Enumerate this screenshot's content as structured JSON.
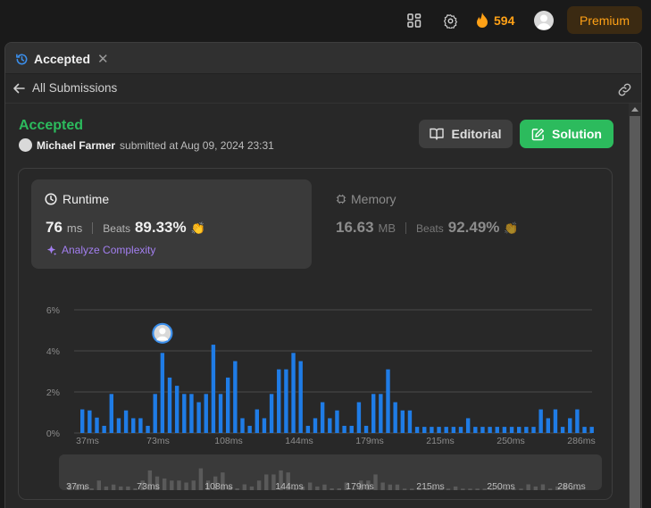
{
  "topbar": {
    "streak_count": "594",
    "premium_label": "Premium"
  },
  "tab": {
    "label": "Accepted"
  },
  "nav": {
    "back_label": "All Submissions"
  },
  "submission": {
    "status": "Accepted",
    "user": "Michael Farmer",
    "submitted_text": "submitted at Aug 09, 2024 23:31"
  },
  "buttons": {
    "editorial": "Editorial",
    "solution": "Solution"
  },
  "runtime": {
    "title": "Runtime",
    "value": "76",
    "unit": "ms",
    "beats_label": "Beats",
    "beats_pct": "89.33%",
    "analyze_label": "Analyze Complexity"
  },
  "memory": {
    "title": "Memory",
    "value": "16.63",
    "unit": "MB",
    "beats_label": "Beats",
    "beats_pct": "92.49%"
  },
  "colors": {
    "accent_green": "#2cbb5d",
    "bar_blue": "#1f7ce6",
    "streak_orange": "#ffa116",
    "analyze_purple": "#a37ff0"
  },
  "chart_data": {
    "type": "bar",
    "y_ticks": [
      "6%",
      "4%",
      "2%",
      "0%"
    ],
    "ylim": [
      0,
      6
    ],
    "x_ticks": [
      "37ms",
      "73ms",
      "108ms",
      "144ms",
      "179ms",
      "215ms",
      "250ms",
      "286ms"
    ],
    "highlight_index": 11,
    "values": [
      1.15,
      1.1,
      0.75,
      0.35,
      1.9,
      0.72,
      1.1,
      0.72,
      0.72,
      0.35,
      1.9,
      3.9,
      2.7,
      2.3,
      1.9,
      1.9,
      1.5,
      1.9,
      4.3,
      1.9,
      2.7,
      3.5,
      0.72,
      0.35,
      1.15,
      0.72,
      1.9,
      3.1,
      3.1,
      3.9,
      3.5,
      0.35,
      0.72,
      1.5,
      0.72,
      1.1,
      0.35,
      0.35,
      1.5,
      0.35,
      1.9,
      1.9,
      3.1,
      1.5,
      1.1,
      1.1,
      0.3,
      0.3,
      0.3,
      0.3,
      0.3,
      0.3,
      0.3,
      0.72,
      0.3,
      0.3,
      0.3,
      0.3,
      0.3,
      0.3,
      0.3,
      0.3,
      0.3,
      1.15,
      0.72,
      1.15,
      0.3,
      0.72,
      1.15,
      0.3,
      0.3
    ]
  }
}
